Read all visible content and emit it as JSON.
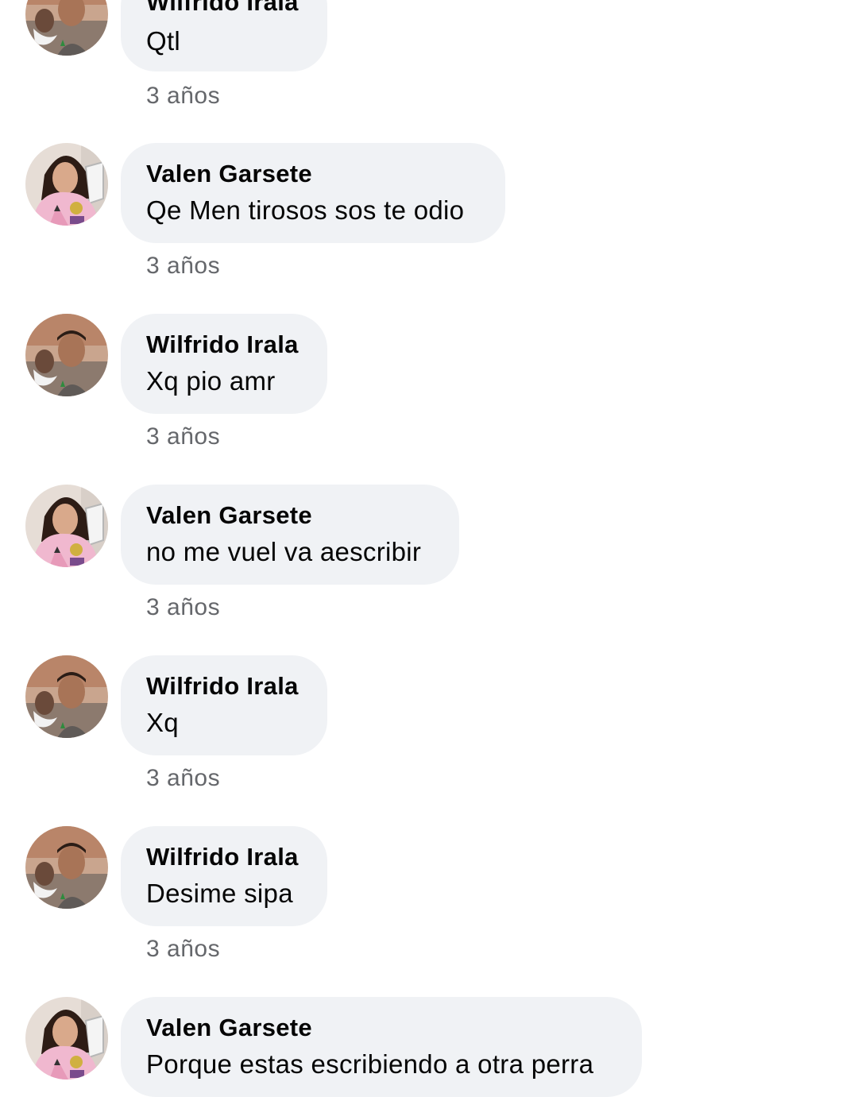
{
  "comments": [
    {
      "author": "Wilfrido Irala",
      "text": "Qtl",
      "time": "3 años",
      "avatar": "wilfrido"
    },
    {
      "author": "Valen Garsete",
      "text": "Qe Men tirosos sos te odio",
      "time": "3 años",
      "avatar": "valen"
    },
    {
      "author": "Wilfrido Irala",
      "text": "Xq pio amr",
      "time": "3 años",
      "avatar": "wilfrido"
    },
    {
      "author": "Valen Garsete",
      "text": "no me vuel va aescribir",
      "time": "3 años",
      "avatar": "valen"
    },
    {
      "author": "Wilfrido Irala",
      "text": "Xq",
      "time": "3 años",
      "avatar": "wilfrido"
    },
    {
      "author": "Wilfrido Irala",
      "text": "Desime sipa",
      "time": "3 años",
      "avatar": "wilfrido"
    },
    {
      "author": "Valen Garsete",
      "text": "Porque estas escribiendo a otra perra",
      "time": "",
      "avatar": "valen"
    }
  ],
  "colors": {
    "bubble": "#f0f2f5",
    "timestamp": "#65676b",
    "text": "#050505"
  }
}
